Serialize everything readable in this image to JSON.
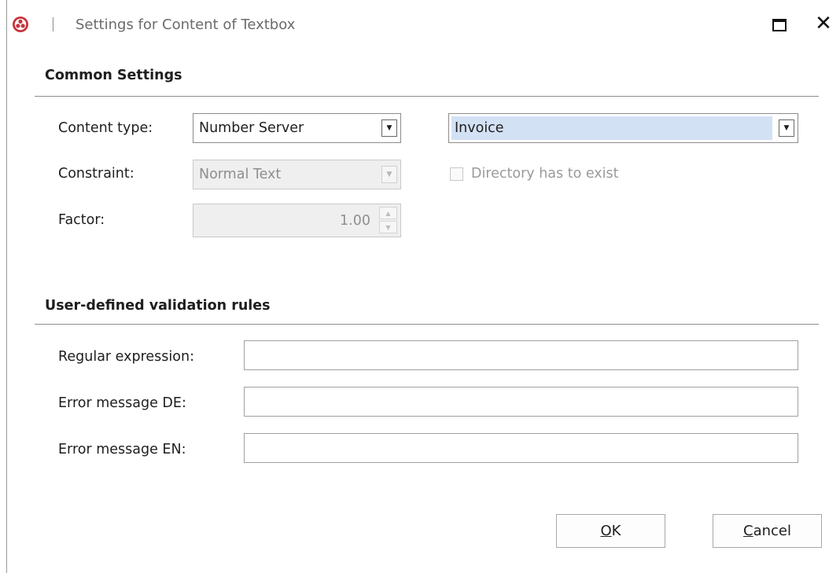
{
  "window": {
    "title": "Settings for Content of Textbox",
    "icon": "app-logo-icon",
    "maximize_icon": "maximize-icon",
    "close_label": "✕"
  },
  "common_settings": {
    "heading": "Common Settings",
    "content_type": {
      "label": "Content type:",
      "value": "Number Server",
      "secondary_value": "Invoice"
    },
    "constraint": {
      "label": "Constraint:",
      "value": "Normal Text",
      "enabled": false
    },
    "directory_checkbox": {
      "label": "Directory has to exist",
      "checked": false,
      "enabled": false
    },
    "factor": {
      "label": "Factor:",
      "value": "1.00",
      "enabled": false
    }
  },
  "validation": {
    "heading": "User-defined validation rules",
    "regex": {
      "label": "Regular expression:",
      "value": ""
    },
    "error_de": {
      "label": "Error message DE:",
      "value": ""
    },
    "error_en": {
      "label": "Error message EN:",
      "value": ""
    }
  },
  "buttons": {
    "ok": {
      "mnemonic": "O",
      "rest": "K"
    },
    "cancel": {
      "mnemonic": "C",
      "rest": "ancel"
    }
  },
  "colors": {
    "highlight": "#d3e1f4",
    "logo": "#c8333a"
  }
}
